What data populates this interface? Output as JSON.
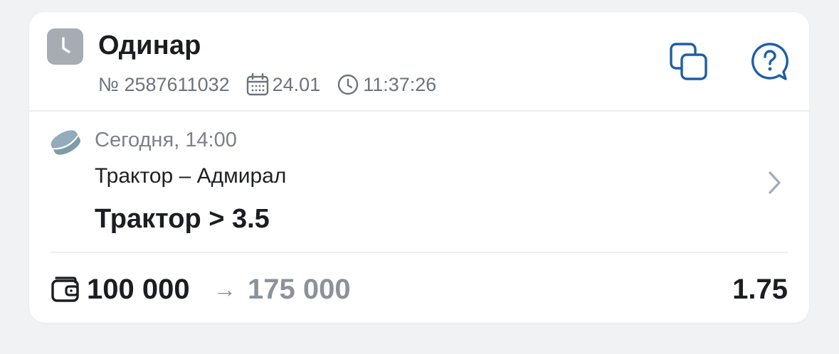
{
  "bet": {
    "type": "Одинар",
    "number": "№ 2587611032",
    "date": "24.01",
    "time": "11:37:26",
    "status_icon": "clock-icon"
  },
  "actions": {
    "copy_icon": "copy-icon",
    "help_icon": "help-chat-icon"
  },
  "event": {
    "sport_icon": "hockey-puck-icon",
    "datetime": "Сегодня, 14:00",
    "teams": "Трактор – Адмирал",
    "outcome": "Трактор > 3.5"
  },
  "footer": {
    "stake": "100 000",
    "arrow": "→",
    "payout": "175 000",
    "odds": "1.75"
  },
  "colors": {
    "accent": "#1f5fa6",
    "badge": "#a6abb4",
    "muted": "#8c929b",
    "sport_icon": "#7e9aab"
  }
}
